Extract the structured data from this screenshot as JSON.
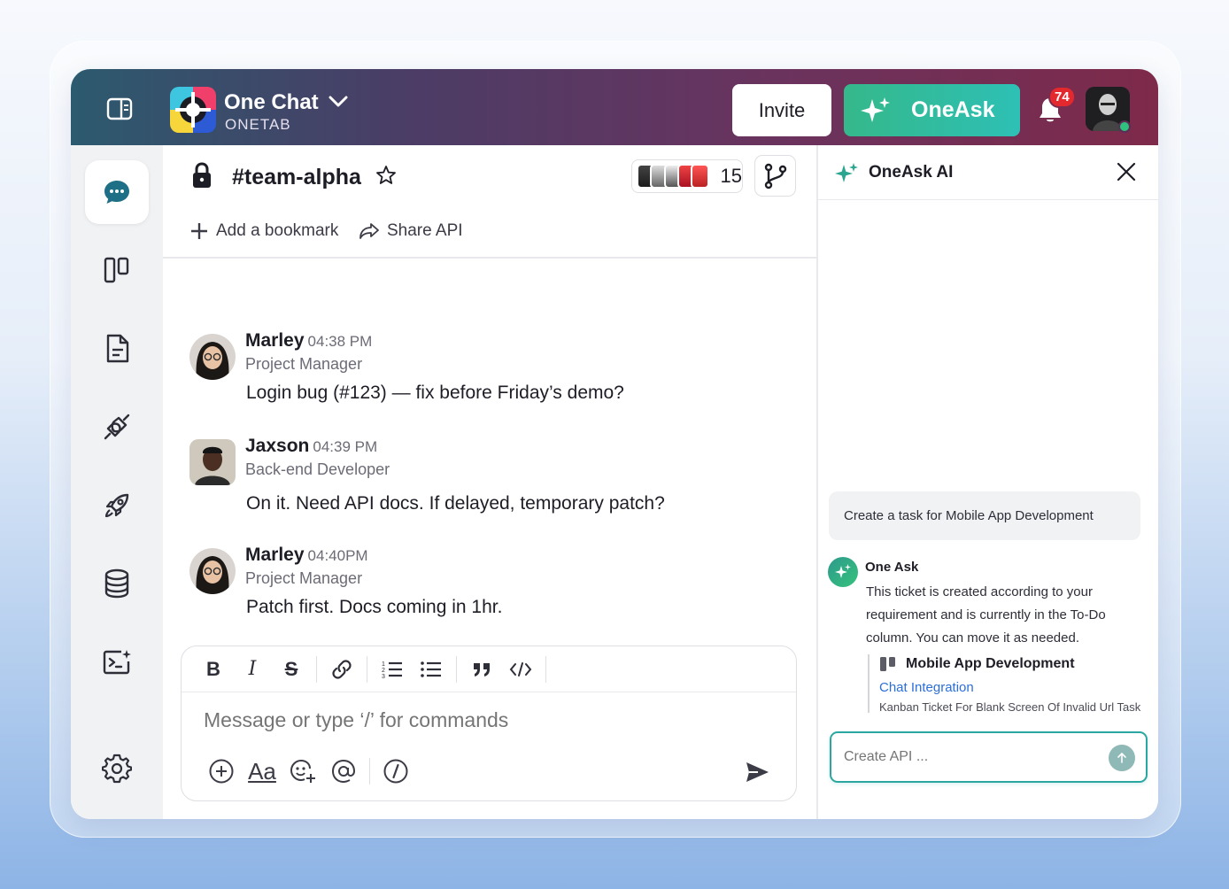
{
  "topbar": {
    "brand_name": "One Chat",
    "brand_sub": "ONETAB",
    "invite_label": "Invite",
    "oneask_label": "OneAsk",
    "notification_count": "74",
    "colors": {
      "accent": "#2ec0b5",
      "badge": "#e3282e"
    }
  },
  "sidebar": {
    "items": [
      {
        "icon": "chat-bubble-icon",
        "active": true
      },
      {
        "icon": "board-icon"
      },
      {
        "icon": "document-icon"
      },
      {
        "icon": "plug-icon"
      },
      {
        "icon": "rocket-icon"
      },
      {
        "icon": "database-icon"
      },
      {
        "icon": "terminal-sparkle-icon"
      },
      {
        "icon": "gear-icon"
      }
    ]
  },
  "channel": {
    "name": "#team-alpha",
    "member_count": "15",
    "add_bookmark": "Add a bookmark",
    "share_api": "Share API"
  },
  "messages": [
    {
      "name": "Marley",
      "time": "04:38 PM",
      "role": "Project Manager",
      "text": "Login bug (#123) — fix before Friday’s demo?"
    },
    {
      "name": "Jaxson",
      "time": "04:39 PM",
      "role": "Back-end Developer",
      "text": "On it. Need API docs. If delayed, temporary patch?"
    },
    {
      "name": "Marley",
      "time": "04:40PM",
      "role": "Project Manager",
      "text": "Patch first. Docs coming in 1hr."
    }
  ],
  "composer": {
    "placeholder": "Message or type ‘/’ for commands",
    "toolbar": [
      "B",
      "I",
      "S",
      "link",
      "ordered-list",
      "bullet-list",
      "quote",
      "code"
    ],
    "font_label": "Aa"
  },
  "ai_panel": {
    "title": "OneAsk AI",
    "prompt": "Create a task for Mobile App Development",
    "responder": "One Ask",
    "response": "This ticket is created according to your requirement and is currently in the To-Do column. You can move it as needed.",
    "ticket": {
      "project": "Mobile App Development",
      "link": "Chat Integration",
      "subtitle": "Kanban Ticket For Blank Screen Of Invalid Url Task"
    },
    "input_placeholder": "Create API ..."
  }
}
